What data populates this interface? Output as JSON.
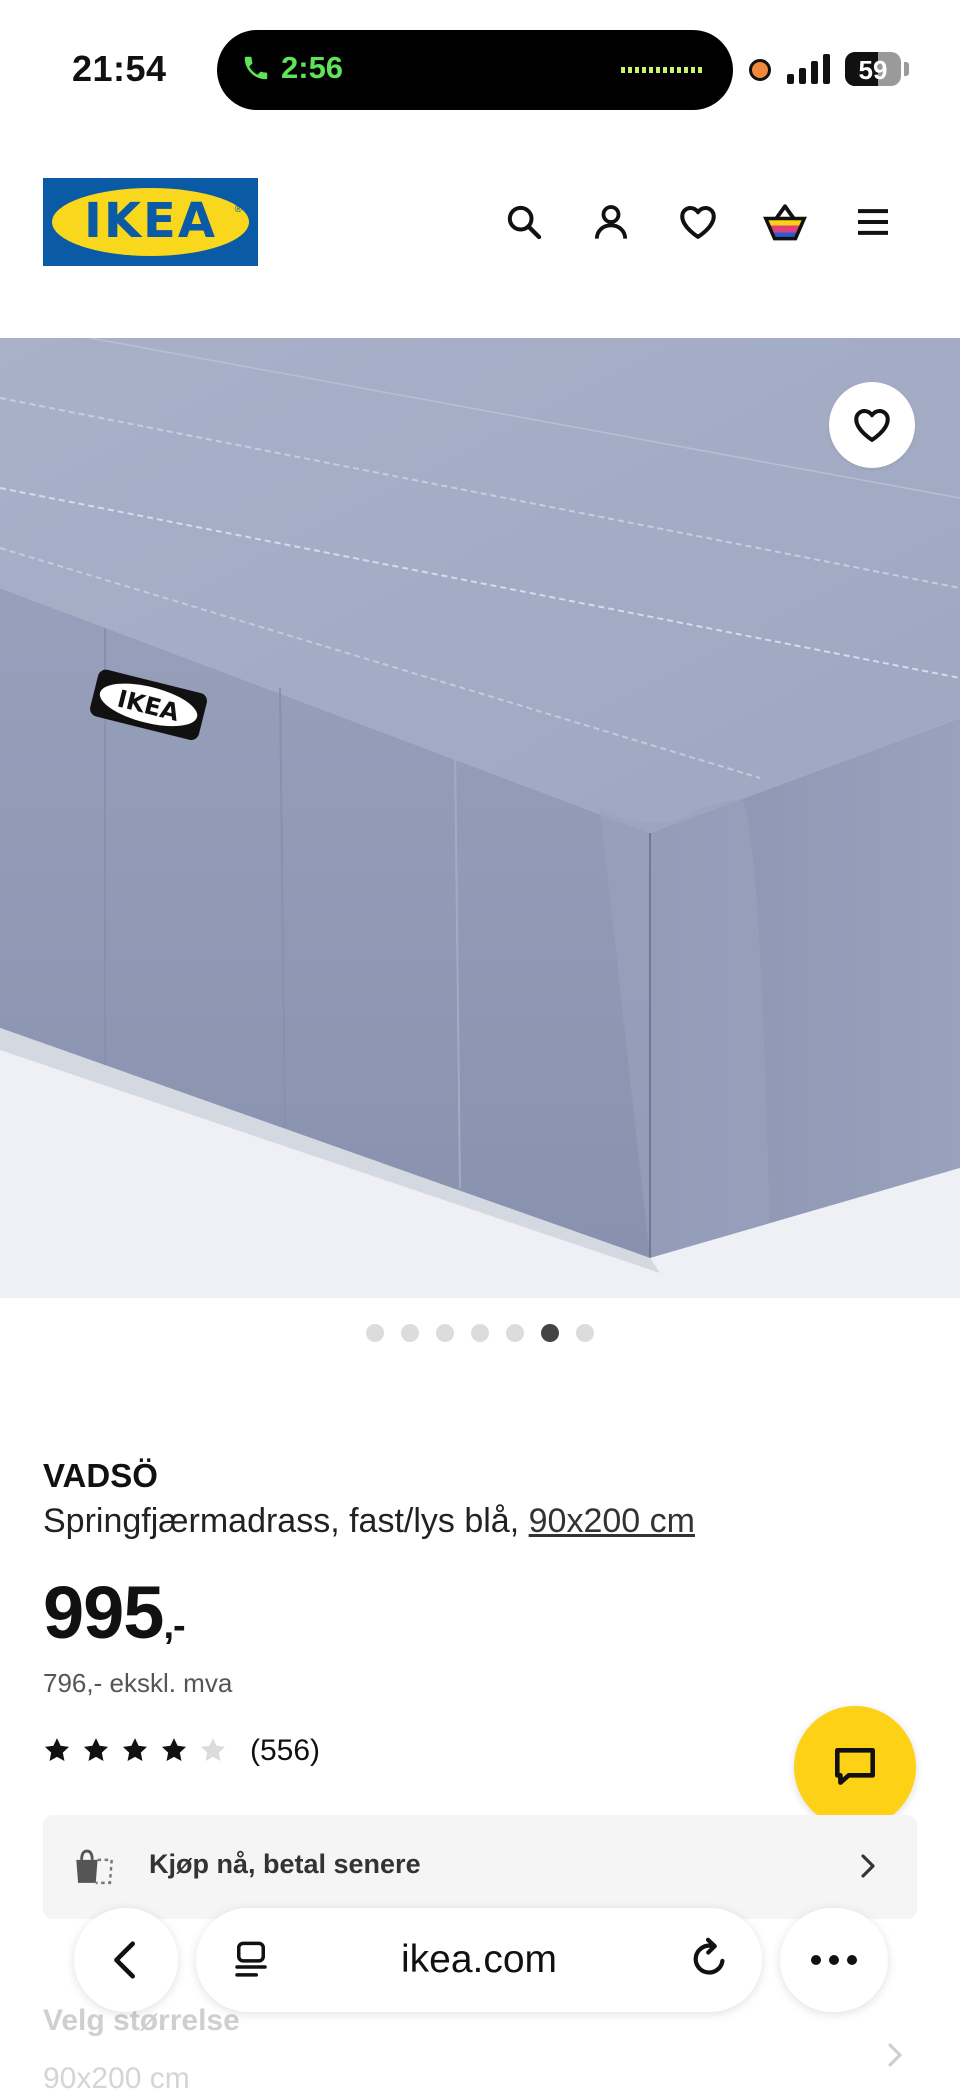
{
  "status_bar": {
    "time": "21:54",
    "call_timer": "2:56",
    "battery_level": "59",
    "battery_fraction": 0.59
  },
  "header": {
    "logo_text": "IKEA",
    "icons": [
      "search-icon",
      "user-icon",
      "heart-icon",
      "basket-icon",
      "menu-icon"
    ]
  },
  "product": {
    "image_label": "IKEA",
    "carousel": {
      "total": 7,
      "active_index": 5
    },
    "name": "VADSÖ",
    "description": "Springfjærmadrass, fast/lys blå, ",
    "size_link": "90x200 cm",
    "price_main": "995",
    "price_suffix": ",-",
    "price_excl_vat": "796,- ekskl. mva",
    "rating": {
      "stars": 4,
      "max": 5,
      "count": "(556)"
    }
  },
  "payment_option": {
    "label": "Kjøp nå, betal senere"
  },
  "below_fold": {
    "size_heading": "Velg størrelse",
    "size_value": "90x200 cm"
  },
  "browser": {
    "url": "ikea.com"
  },
  "colors": {
    "ikea_blue": "#0a5aa6",
    "ikea_yellow": "#f9d71c",
    "chat_yellow": "#fcd116",
    "call_green": "#5ee35a"
  }
}
